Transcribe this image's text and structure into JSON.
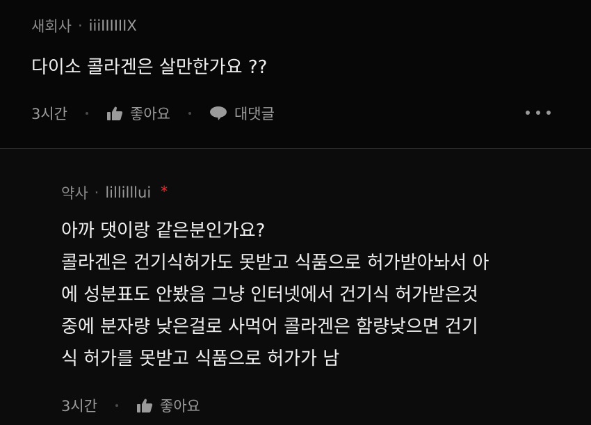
{
  "top_comment": {
    "author": "새회사",
    "separator": "·",
    "handle": "iiiIIIIIIX",
    "text": "다이소 콜라겐은 살만한가요 ??",
    "time": "3시간",
    "like_label": "좋아요",
    "reply_label": "대댓글",
    "more_icon": "more-horizontal-icon"
  },
  "reply_comment": {
    "author": "약사",
    "separator": "·",
    "handle": "lillilllui",
    "op_mark": "*",
    "lines": [
      "아까 댓이랑 같은분인가요?",
      "콜라겐은 건기식허가도 못받고 식품으로 허가받아놔서 아",
      "에 성분표도 안봤음 그냥 인터넷에서 건기식 허가받은것",
      "중에 분자량 낮은걸로 사먹어 콜라겐은 함량낮으면 건기",
      "식 허가를 못받고 식품으로 허가가 남"
    ],
    "time": "3시간",
    "like_label": "좋아요"
  },
  "colors": {
    "background": "#000000",
    "reply_background": "#0c0c0c",
    "text": "#f0f0f0",
    "meta": "#8c8c8c",
    "op_mark": "#e03131"
  }
}
